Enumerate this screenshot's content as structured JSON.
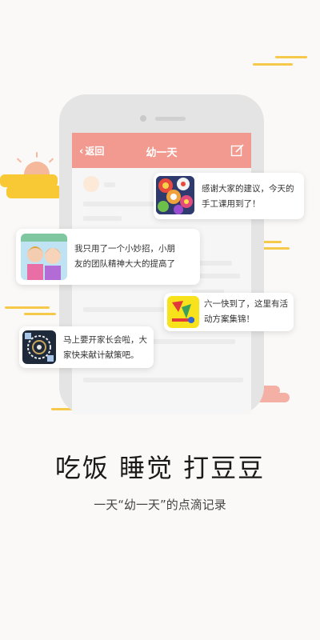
{
  "app": {
    "back_label": "返回",
    "title": "幼一天",
    "back_icon": "chevron-left-icon",
    "edit_icon": "edit-icon"
  },
  "messages": [
    {
      "avatar": "flower-collage-avatar",
      "text_line1": "感谢大家的建议，今天的",
      "text_line2": "手工课用到了！"
    },
    {
      "avatar": "kids-photo-avatar",
      "text_line1": "我只用了一个小妙招，小朋",
      "text_line2": "友的团队精神大大的提高了"
    },
    {
      "avatar": "yellow-flyer-avatar",
      "text_line1": "六一快到了，这里有活",
      "text_line2": "动方案集锦！"
    },
    {
      "avatar": "dark-pattern-avatar",
      "text_line1": "马上要开家长会啦，大",
      "text_line2": "家快来献计献策吧。"
    }
  ],
  "headline": "吃饭  睡觉  打豆豆",
  "subline": "一天“幼一天”的点滴记录",
  "colors": {
    "appbar": "#f29a8f",
    "background": "#fbf9f7",
    "accent_yellow": "#f8c934",
    "accent_pink": "#f5b0a6"
  }
}
